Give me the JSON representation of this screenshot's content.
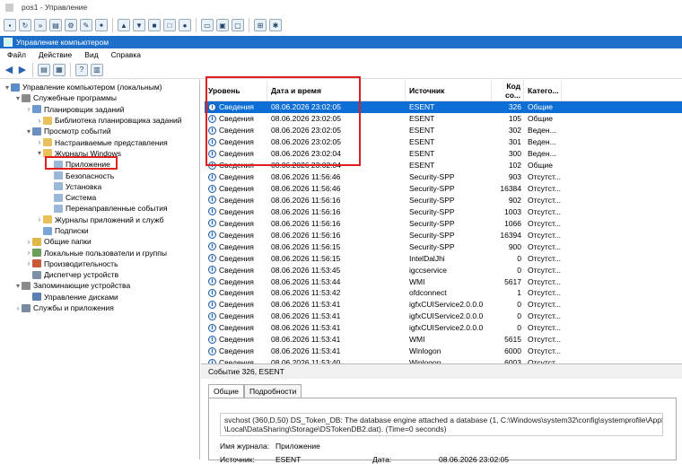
{
  "remote": {
    "title": "pos1 - Управление"
  },
  "window": {
    "title": "Управление компьютером"
  },
  "menu": [
    "Файл",
    "Действие",
    "Вид",
    "Справка"
  ],
  "tree": [
    {
      "label": "Управление компьютером (локальным)",
      "indent": 0,
      "twisty": "▾",
      "icon": "computer-icon"
    },
    {
      "label": "Служебные программы",
      "indent": 1,
      "twisty": "▾",
      "icon": "tools-icon"
    },
    {
      "label": "Планировщик заданий",
      "indent": 2,
      "twisty": "›",
      "icon": "scheduler-icon"
    },
    {
      "label": "Библиотека планировщика заданий",
      "indent": 3,
      "twisty": "›",
      "icon": "folder-icon"
    },
    {
      "label": "Просмотр событий",
      "indent": 2,
      "twisty": "▾",
      "icon": "event-viewer-icon"
    },
    {
      "label": "Настраиваемые представления",
      "indent": 3,
      "twisty": "›",
      "icon": "folder-icon"
    },
    {
      "label": "Журналы Windows",
      "indent": 3,
      "twisty": "▾",
      "icon": "folder-icon"
    },
    {
      "label": "Приложение",
      "indent": 4,
      "twisty": "",
      "icon": "log-icon"
    },
    {
      "label": "Безопасность",
      "indent": 4,
      "twisty": "",
      "icon": "log-icon"
    },
    {
      "label": "Установка",
      "indent": 4,
      "twisty": "",
      "icon": "log-icon"
    },
    {
      "label": "Система",
      "indent": 4,
      "twisty": "",
      "icon": "log-icon"
    },
    {
      "label": "Перенаправленные события",
      "indent": 4,
      "twisty": "",
      "icon": "log-icon"
    },
    {
      "label": "Журналы приложений и служб",
      "indent": 3,
      "twisty": "›",
      "icon": "folder-icon"
    },
    {
      "label": "Подписки",
      "indent": 3,
      "twisty": "",
      "icon": "subscription-icon"
    },
    {
      "label": "Общие папки",
      "indent": 2,
      "twisty": "›",
      "icon": "shared-folder-icon"
    },
    {
      "label": "Локальные пользователи и группы",
      "indent": 2,
      "twisty": "›",
      "icon": "users-icon"
    },
    {
      "label": "Производительность",
      "indent": 2,
      "twisty": "›",
      "icon": "performance-icon"
    },
    {
      "label": "Диспетчер устройств",
      "indent": 2,
      "twisty": "",
      "icon": "device-manager-icon"
    },
    {
      "label": "Запоминающие устройства",
      "indent": 1,
      "twisty": "▾",
      "icon": "storage-icon"
    },
    {
      "label": "Управление дисками",
      "indent": 2,
      "twisty": "",
      "icon": "disk-icon"
    },
    {
      "label": "Службы и приложения",
      "indent": 1,
      "twisty": "›",
      "icon": "services-icon"
    }
  ],
  "grid": {
    "columns": [
      "Уровень",
      "Дата и время",
      "Источник",
      "Код со...",
      "Катего..."
    ],
    "rows": [
      [
        "Сведения",
        "08.06.2026 23:02:05",
        "ESENT",
        "326",
        "Общие"
      ],
      [
        "Сведения",
        "08.06.2026 23:02:05",
        "ESENT",
        "105",
        "Общие"
      ],
      [
        "Сведения",
        "08.06.2026 23:02:05",
        "ESENT",
        "302",
        "Веден..."
      ],
      [
        "Сведения",
        "08.06.2026 23:02:05",
        "ESENT",
        "301",
        "Веден..."
      ],
      [
        "Сведения",
        "08.06.2026 23:02:04",
        "ESENT",
        "300",
        "Веден..."
      ],
      [
        "Сведения",
        "08.06.2026 23:02:04",
        "ESENT",
        "102",
        "Общие"
      ],
      [
        "Сведения",
        "08.06.2026 11:56:46",
        "Security-SPP",
        "903",
        "Отсутст..."
      ],
      [
        "Сведения",
        "08.06.2026 11:56:46",
        "Security-SPP",
        "16384",
        "Отсутст..."
      ],
      [
        "Сведения",
        "08.06.2026 11:56:16",
        "Security-SPP",
        "902",
        "Отсутст..."
      ],
      [
        "Сведения",
        "08.06.2026 11:56:16",
        "Security-SPP",
        "1003",
        "Отсутст..."
      ],
      [
        "Сведения",
        "08.06.2026 11:56:16",
        "Security-SPP",
        "1066",
        "Отсутст..."
      ],
      [
        "Сведения",
        "08.06.2026 11:56:16",
        "Security-SPP",
        "16394",
        "Отсутст..."
      ],
      [
        "Сведения",
        "08.06.2026 11:56:15",
        "Security-SPP",
        "900",
        "Отсутст..."
      ],
      [
        "Сведения",
        "08.06.2026 11:56:15",
        "IntelDalJhi",
        "0",
        "Отсутст..."
      ],
      [
        "Сведения",
        "08.06.2026 11:53:45",
        "igccservice",
        "0",
        "Отсутст..."
      ],
      [
        "Сведения",
        "08.06.2026 11:53:44",
        "WMI",
        "5617",
        "Отсутст..."
      ],
      [
        "Сведения",
        "08.06.2026 11:53:42",
        "ofdconnect",
        "1",
        "Отсутст..."
      ],
      [
        "Сведения",
        "08.06.2026 11:53:41",
        "igfxCUIService2.0.0.0",
        "0",
        "Отсутст..."
      ],
      [
        "Сведения",
        "08.06.2026 11:53:41",
        "igfxCUIService2.0.0.0",
        "0",
        "Отсутст..."
      ],
      [
        "Сведения",
        "08.06.2026 11:53:41",
        "igfxCUIService2.0.0.0",
        "0",
        "Отсутст..."
      ],
      [
        "Сведения",
        "08.06.2026 11:53:41",
        "WMI",
        "5615",
        "Отсутст..."
      ],
      [
        "Сведения",
        "08.06.2026 11:53:41",
        "Winlogon",
        "6000",
        "Отсутст..."
      ],
      [
        "Сведения",
        "08.06.2026 11:53:40",
        "Winlogon",
        "6003",
        "Отсутст..."
      ]
    ]
  },
  "details": {
    "title": "Событие 326, ESENT",
    "tabs": [
      "Общие",
      "Подробности"
    ],
    "text1": "svchost (360,D,50) DS_Token_DB: The database engine attached a database (1, C:\\Windows\\system32\\config\\systemprofile\\AppData",
    "text2": "\\Local\\DataSharing\\Storage\\DSTokenDB2.dat). (Time=0 seconds)",
    "log_label": "Имя журнала:",
    "log_value": "Приложение",
    "source_label": "Источник:",
    "source_value": "ESENT",
    "date_label": "Дата:",
    "date_value": "08.06.2026 23:02:05"
  },
  "colors": {
    "accent": "#0d6fd6",
    "highlight": "#e02020"
  }
}
